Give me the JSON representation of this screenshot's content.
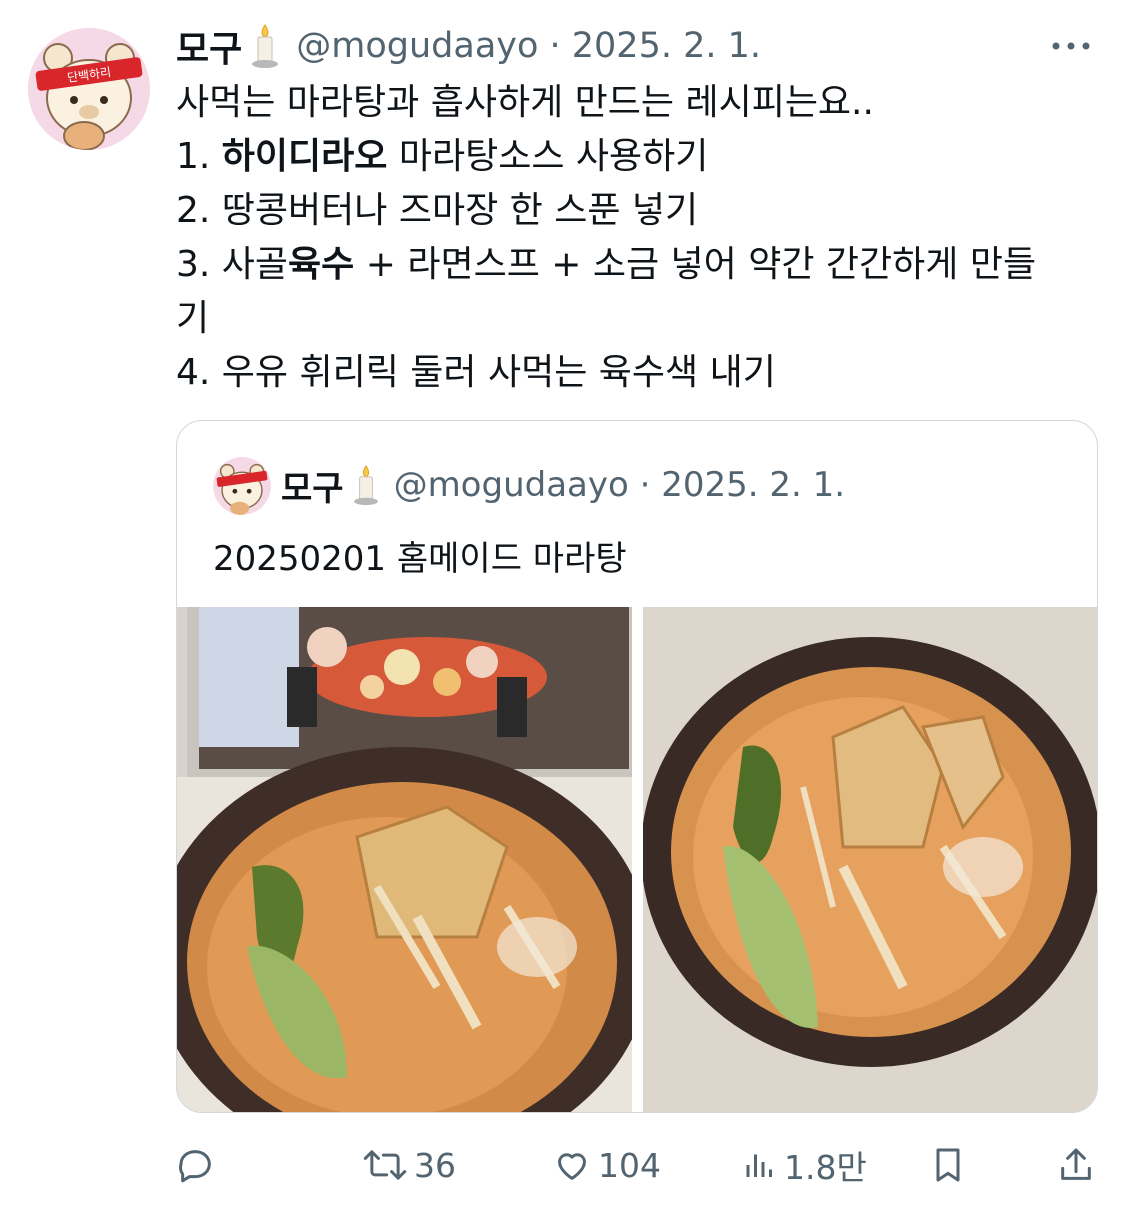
{
  "tweet": {
    "author_name": "모구",
    "handle_date": "@mogudaayo · 2025. 2. 1.",
    "lines": [
      {
        "pre": "사먹는 마라탕과 흡사하게 만드는 레시피는요..",
        "bold": "",
        "post": ""
      },
      {
        "pre": "1. ",
        "bold": "하이디라오",
        "post": " 마라탕소스 사용하기"
      },
      {
        "pre": "2. 땅콩버터나 즈마장 한 스푼 넣기",
        "bold": "",
        "post": ""
      },
      {
        "pre": "3. 사골",
        "bold": "육수",
        "post": " + 라면스프 + 소금 넣어 약간 간간하게 만들"
      },
      {
        "pre": "기",
        "bold": "",
        "post": ""
      },
      {
        "pre": "4. 우유 휘리릭 둘러 사먹는 육수색 내기",
        "bold": "",
        "post": ""
      }
    ],
    "avatar_badge": "단백하리"
  },
  "quote": {
    "author_name": "모구",
    "handle_date": "@mogudaayo · 2025. 2. 1.",
    "text": "20250201 홈메이드 마라탕"
  },
  "actions": {
    "replies": "",
    "retweets": "36",
    "likes": "104",
    "views": "1.8만"
  },
  "icons": {
    "reply": "reply-icon",
    "retweet": "retweet-icon",
    "like": "heart-icon",
    "views": "views-chart-icon",
    "bookmark": "bookmark-icon",
    "share": "share-icon",
    "more": "more-dots-icon",
    "candle": "candle-emoji-icon"
  },
  "colors": {
    "text": "#0f1419",
    "muted": "#536471",
    "border": "#cfd9de",
    "avatar_bg": "#f6d9e6",
    "headband": "#d8262b"
  }
}
